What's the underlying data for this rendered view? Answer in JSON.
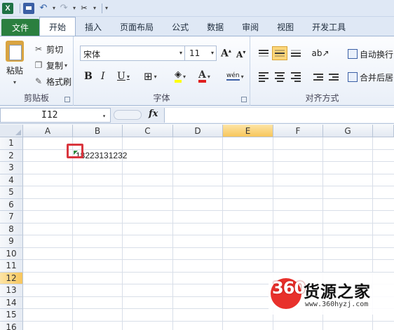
{
  "quick_access": {
    "app_icon": "excel-icon",
    "app_letter": "X",
    "icons": [
      "save-icon",
      "undo-icon",
      "redo-icon",
      "customize-icon"
    ]
  },
  "tabs": [
    {
      "label": "文件",
      "active": false
    },
    {
      "label": "开始",
      "active": true
    },
    {
      "label": "插入",
      "active": false
    },
    {
      "label": "页面布局",
      "active": false
    },
    {
      "label": "公式",
      "active": false
    },
    {
      "label": "数据",
      "active": false
    },
    {
      "label": "审阅",
      "active": false
    },
    {
      "label": "视图",
      "active": false
    },
    {
      "label": "开发工具",
      "active": false
    }
  ],
  "clipboard": {
    "paste": "粘贴",
    "cut": "剪切",
    "copy": "复制",
    "format_painter": "格式刷",
    "group_label": "剪贴板"
  },
  "font": {
    "name": "宋体",
    "size": "11",
    "bold": "B",
    "italic": "I",
    "underline": "U",
    "grow": "A",
    "shrink": "A",
    "font_color": "A",
    "phonetic": "wén",
    "group_label": "字体"
  },
  "alignment": {
    "wrap_text": "自动换行",
    "merge_center": "合并后居",
    "group_label": "对齐方式"
  },
  "formula_bar": {
    "name_box": "I12",
    "fx": "fx",
    "value": ""
  },
  "sheet": {
    "columns": [
      "A",
      "B",
      "C",
      "D",
      "E",
      "F",
      "G"
    ],
    "selected_column": "E",
    "rows": [
      "1",
      "2",
      "3",
      "4",
      "5",
      "6",
      "7",
      "8",
      "9",
      "10",
      "11",
      "12",
      "13",
      "14",
      "15",
      "16"
    ],
    "selected_row": "12",
    "cell_b2": "18223131232"
  },
  "watermark": {
    "logo": "360",
    "name": "货源之家",
    "url": "www.360hyzj.com"
  },
  "colors": {
    "file_tab": "#2b7f3f",
    "ribbon_bg": "#dfe8f5",
    "selected_header": "#f7c65c",
    "highlight_box": "#d9363e",
    "error_triangle": "#2b8a3e",
    "watermark_red": "#e8312c"
  }
}
